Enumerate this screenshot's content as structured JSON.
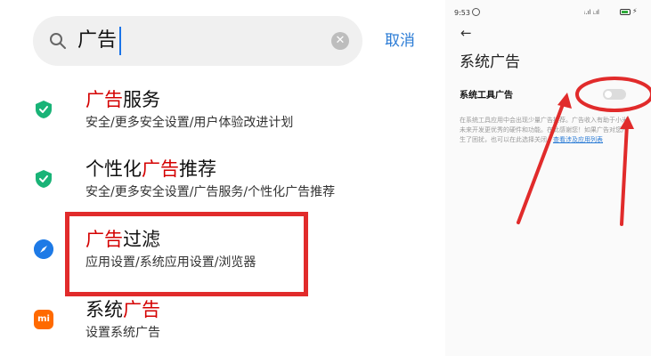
{
  "left": {
    "search": {
      "query": "广告",
      "clear_symbol": "✕",
      "cancel_label": "取消"
    },
    "results": [
      {
        "title_highlight": "广告",
        "title_after": "服务",
        "subtitle": "安全/更多安全设置/用户体验改进计划",
        "icon": "security-shield-icon"
      },
      {
        "title_before": "个性化",
        "title_highlight": "广告",
        "title_after": "推荐",
        "subtitle": "安全/更多安全设置/广告服务/个性化广告推荐",
        "icon": "security-shield-icon"
      },
      {
        "title_highlight": "广告",
        "title_after": "过滤",
        "subtitle": "应用设置/系统应用设置/浏览器",
        "icon": "browser-compass-icon"
      },
      {
        "title_before": "系统",
        "title_highlight": "广告",
        "subtitle": "设置系统广告",
        "icon": "mi-logo-icon"
      }
    ],
    "mi_logo_text": "mi",
    "colors": {
      "highlight_text": "#d40000",
      "annotation_box": "#e12b2b",
      "accent_blue": "#2a7bd5",
      "shield_green": "#19b377"
    }
  },
  "right": {
    "status_bar": {
      "time": "9:53",
      "signal_text": "ᵢ.ıl ᵢ.ıl"
    },
    "page_title": "系统广告",
    "setting_label": "系统工具广告",
    "toggle_on": false,
    "description_text": "在系统工具应用中会出现少量广告推荐。广告收入有助于小米未来开发更优秀的硬件和功能。在此感谢您！如果广告对您产生了困扰，也可以在此选择关闭。",
    "description_link": "查看涉及应用列表"
  }
}
